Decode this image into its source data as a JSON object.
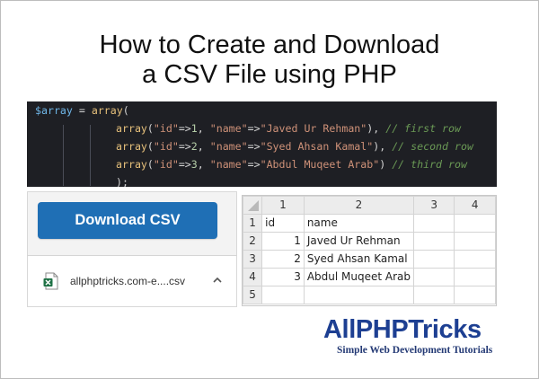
{
  "title": {
    "line1": "How to Create and Download",
    "line2": "a CSV File using PHP"
  },
  "code": {
    "lines": [
      {
        "indent": 0,
        "tokens": [
          {
            "t": "$array",
            "c": "var"
          },
          {
            "t": " = ",
            "c": "op"
          },
          {
            "t": "array",
            "c": "fn"
          },
          {
            "t": "(",
            "c": "op"
          }
        ]
      },
      {
        "indent": 1,
        "tokens": [
          {
            "t": "array",
            "c": "fn"
          },
          {
            "t": "(",
            "c": "op"
          },
          {
            "t": "\"id\"",
            "c": "str"
          },
          {
            "t": "=>",
            "c": "op"
          },
          {
            "t": "1",
            "c": "num"
          },
          {
            "t": ", ",
            "c": "op"
          },
          {
            "t": "\"name\"",
            "c": "str"
          },
          {
            "t": "=>",
            "c": "op"
          },
          {
            "t": "\"Javed Ur Rehman\"",
            "c": "str"
          },
          {
            "t": "), ",
            "c": "op"
          },
          {
            "t": "// first row",
            "c": "cmt"
          }
        ]
      },
      {
        "indent": 1,
        "tokens": [
          {
            "t": "array",
            "c": "fn"
          },
          {
            "t": "(",
            "c": "op"
          },
          {
            "t": "\"id\"",
            "c": "str"
          },
          {
            "t": "=>",
            "c": "op"
          },
          {
            "t": "2",
            "c": "num"
          },
          {
            "t": ", ",
            "c": "op"
          },
          {
            "t": "\"name\"",
            "c": "str"
          },
          {
            "t": "=>",
            "c": "op"
          },
          {
            "t": "\"Syed Ahsan Kamal\"",
            "c": "str"
          },
          {
            "t": "), ",
            "c": "op"
          },
          {
            "t": "// second row",
            "c": "cmt"
          }
        ]
      },
      {
        "indent": 1,
        "tokens": [
          {
            "t": "array",
            "c": "fn"
          },
          {
            "t": "(",
            "c": "op"
          },
          {
            "t": "\"id\"",
            "c": "str"
          },
          {
            "t": "=>",
            "c": "op"
          },
          {
            "t": "3",
            "c": "num"
          },
          {
            "t": ", ",
            "c": "op"
          },
          {
            "t": "\"name\"",
            "c": "str"
          },
          {
            "t": "=>",
            "c": "op"
          },
          {
            "t": "\"Abdul Muqeet Arab\"",
            "c": "str"
          },
          {
            "t": ") ",
            "c": "op"
          },
          {
            "t": "// third row",
            "c": "cmt"
          }
        ]
      },
      {
        "indent": 1,
        "tokens": [
          {
            "t": ");",
            "c": "op"
          }
        ]
      }
    ]
  },
  "download_button": {
    "label": "Download CSV"
  },
  "download_bar": {
    "file_icon": "excel-file-icon",
    "file_name": "allphptricks.com-e....csv",
    "chevron_icon": "chevron-up-icon"
  },
  "spreadsheet": {
    "column_headers": [
      "1",
      "2",
      "3",
      "4"
    ],
    "rows": [
      {
        "row": "1",
        "cells": [
          "id",
          "name",
          "",
          ""
        ]
      },
      {
        "row": "2",
        "cells": [
          "1",
          "Javed Ur Rehman",
          "",
          ""
        ]
      },
      {
        "row": "3",
        "cells": [
          "2",
          "Syed Ahsan Kamal",
          "",
          ""
        ]
      },
      {
        "row": "4",
        "cells": [
          "3",
          "Abdul Muqeet Arab",
          "",
          ""
        ]
      },
      {
        "row": "5",
        "cells": [
          "",
          "",
          "",
          ""
        ]
      }
    ]
  },
  "logo": {
    "name": "AllPHPTricks",
    "tagline": "Simple Web Development Tutorials"
  },
  "colors": {
    "button_blue": "#1f6fb5",
    "code_bg": "#1e1f24",
    "logo_navy": "#1d3f92",
    "excel_green": "#1e7145"
  }
}
